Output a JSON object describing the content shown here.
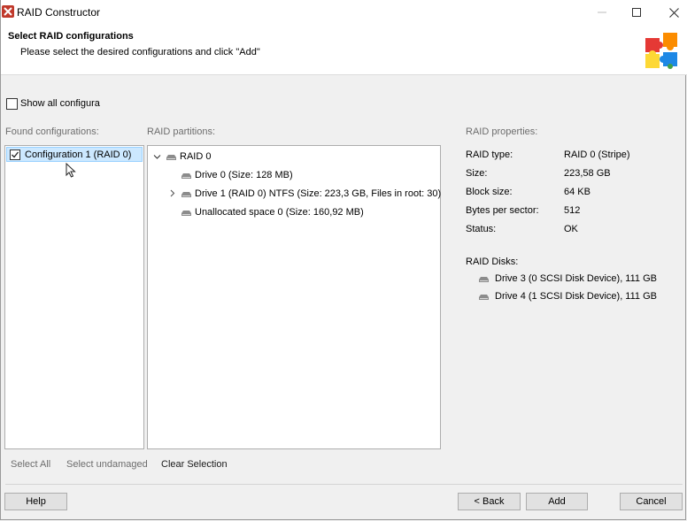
{
  "window": {
    "title": "RAID Constructor"
  },
  "header": {
    "title": "Select RAID configurations",
    "subtitle": "Please select the desired configurations and click \"Add\""
  },
  "show_all": {
    "label": "Show all configura",
    "checked": false
  },
  "found": {
    "label": "Found configurations:",
    "items": [
      {
        "label": "Configuration 1 (RAID 0)",
        "checked": true,
        "selected": true
      }
    ]
  },
  "partitions": {
    "label": "RAID partitions:",
    "root": "RAID 0",
    "children": [
      "Drive 0 (Size: 128 MB)",
      "Drive 1 (RAID 0) NTFS (Size: 223,3 GB, Files in root: 30)",
      "Unallocated space 0 (Size: 160,92 MB)"
    ]
  },
  "properties": {
    "label": "RAID properties:",
    "rows": [
      {
        "key": "RAID type:",
        "value": "RAID 0 (Stripe)"
      },
      {
        "key": "Size:",
        "value": "223,58 GB"
      },
      {
        "key": "Block size:",
        "value": "64 KB"
      },
      {
        "key": "Bytes per sector:",
        "value": "512"
      },
      {
        "key": "Status:",
        "value": "OK"
      }
    ],
    "disks_label": "RAID Disks:",
    "disks": [
      "Drive 3 (0 SCSI Disk Device), 111 GB",
      "Drive 4 (1 SCSI Disk Device), 111 GB"
    ]
  },
  "selection_links": {
    "select_all": "Select All",
    "select_undamaged": "Select undamaged",
    "clear_selection": "Clear Selection"
  },
  "buttons": {
    "help": "Help",
    "back": "< Back",
    "add": "Add",
    "cancel": "Cancel"
  },
  "colors": {
    "selection_bg": "#cce8ff",
    "selection_border": "#99d1ff",
    "muted_text": "#6d6d6d"
  }
}
